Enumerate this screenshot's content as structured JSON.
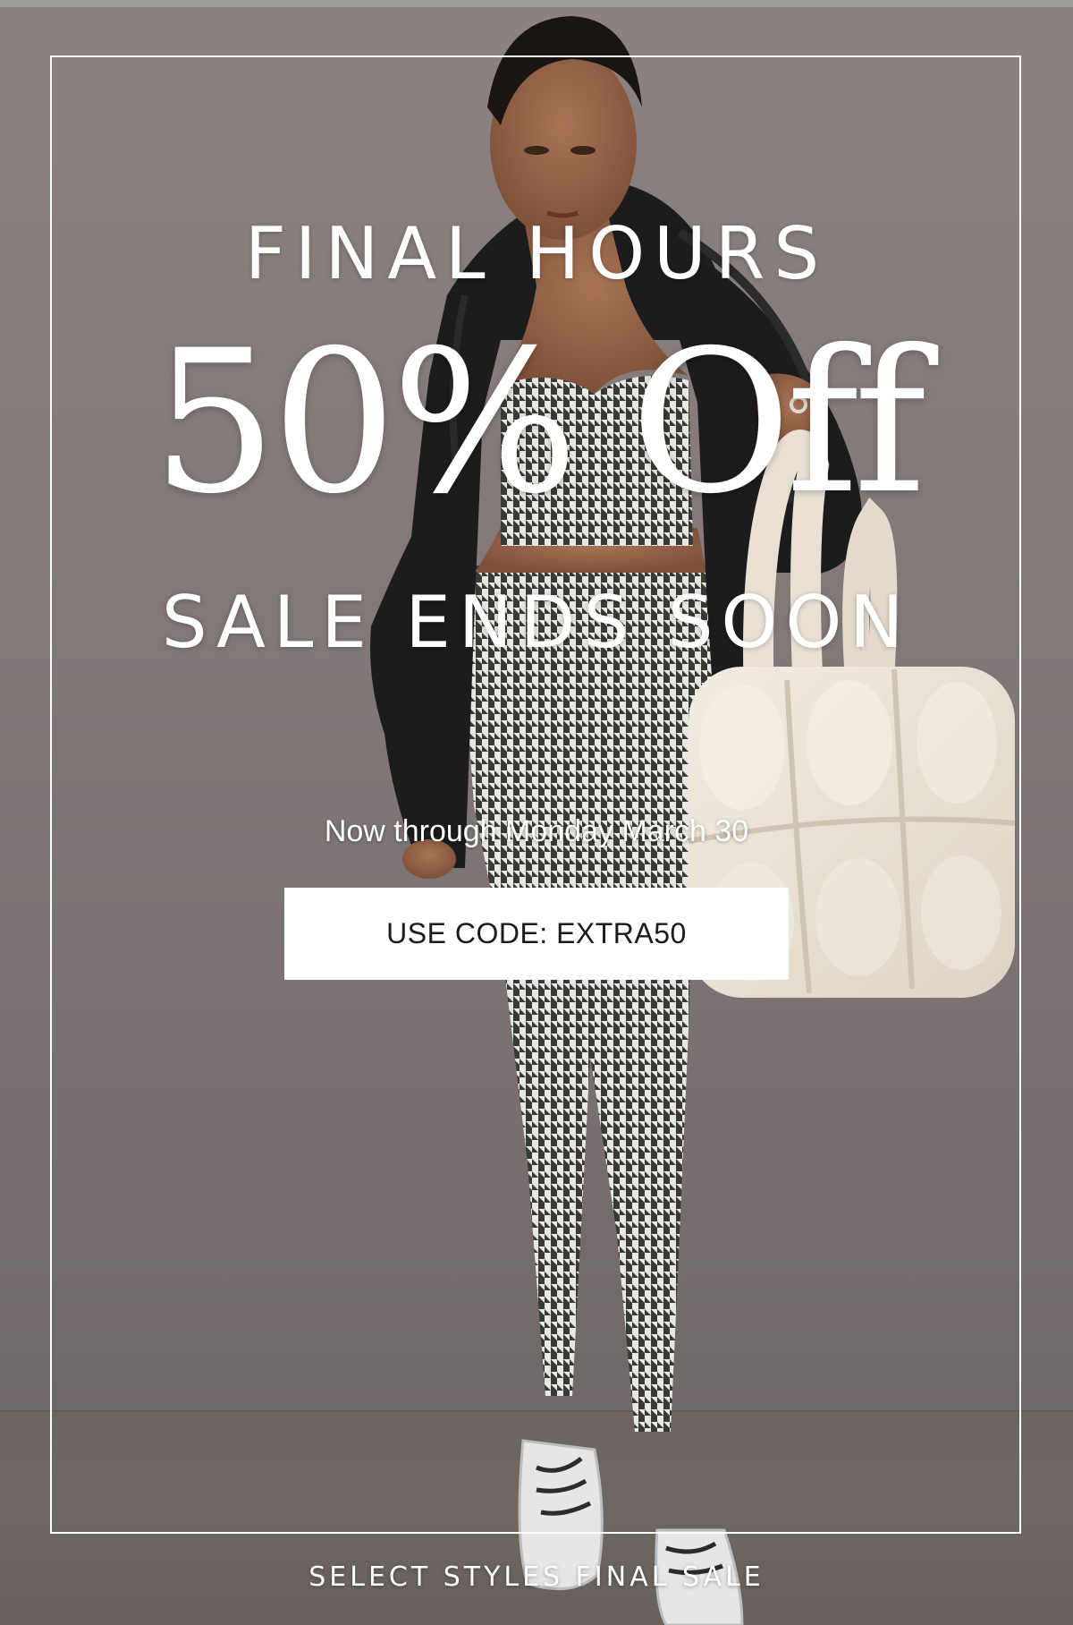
{
  "promo": {
    "eyebrow": "FINAL HOURS",
    "headline": "50% Off",
    "subheadline": "SALE ENDS SOON",
    "date_line": "Now through Monday March 30",
    "code_button_label": "USE CODE: EXTRA50",
    "footer_note": "SELECT STYLES FINAL SALE"
  },
  "colors": {
    "background": "#847a7a",
    "text": "#ffffff",
    "button_bg": "#ffffff",
    "button_text": "#1b1b1b"
  }
}
